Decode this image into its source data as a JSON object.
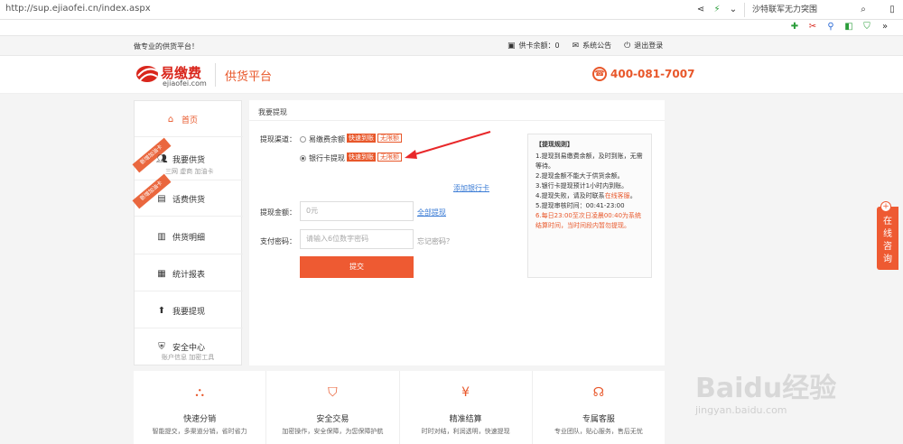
{
  "browser": {
    "url": "http://sup.ejiaofei.cn/index.aspx",
    "search_text": "沙特联军无力突围"
  },
  "topbar": {
    "slogan": "做专业的供货平台！",
    "balance_label": "供卡余额：0",
    "notice_label": "系统公告",
    "logout_label": "退出登录"
  },
  "header": {
    "brand_name": "易缴费",
    "brand_domain": "ejiaofei.com",
    "platform": "供货平台",
    "phone": "400-081-7007"
  },
  "sidebar": {
    "items": [
      {
        "label": "首页",
        "icon": "home-icon"
      },
      {
        "label": "我要供货",
        "sub": "三网 虚商 加油卡",
        "ribbon": "新增加油卡",
        "icon": "users-icon"
      },
      {
        "label": "话费供货",
        "ribbon": "新增加油卡",
        "icon": "phone-card-icon"
      },
      {
        "label": "供货明细",
        "icon": "bar-chart-icon"
      },
      {
        "label": "统计报表",
        "icon": "report-icon"
      },
      {
        "label": "我要提现",
        "icon": "withdraw-icon"
      },
      {
        "label": "安全中心",
        "sub": "账户信息 加密工具",
        "icon": "shield-icon"
      }
    ]
  },
  "main": {
    "breadcrumb": "我要提现",
    "channel_label": "提现渠道：",
    "option1": "易缴费余额",
    "option2": "银行卡提现",
    "tag_fast": "快速到账",
    "tag_free": "无限额",
    "add_card": "添加银行卡",
    "amount_label": "提现金额：",
    "amount_placeholder": "0元",
    "withdraw_all": "全部提现",
    "pwd_label": "支付密码：",
    "pwd_placeholder": "请输入6位数字密码",
    "forgot": "忘记密码？",
    "submit": "提交"
  },
  "rules": {
    "title": "【提现规则】",
    "r1": "1.提现到易缴费余额，及时到账，无需等待。",
    "r2": "2.提现金额不能大于供货余额。",
    "r3": "3.银行卡提现预计1小时内到账。",
    "r4a": "4.提现失败，请及时联系",
    "r4b": "在线客服",
    "r4c": "。",
    "r5": "5.提现审核时间：00:41-23:00",
    "r6": "6.每日23:00至次日凌晨00:40为系统结算时间，当时间段内暂勿提现。"
  },
  "online": {
    "label": "在线咨询"
  },
  "features": [
    {
      "title": "快速分销",
      "desc": "智能提交，多渠道分销，省时省力",
      "icon": "network-icon"
    },
    {
      "title": "安全交易",
      "desc": "加密操作，安全保障，为您保障护航",
      "icon": "shield-icon"
    },
    {
      "title": "精准结算",
      "desc": "时时对结，利润透明，快速提现",
      "icon": "yen-icon"
    },
    {
      "title": "专属客服",
      "desc": "专业团队，贴心服务，售后无忧",
      "icon": "headset-icon"
    }
  ],
  "watermark": {
    "brand": "Baidu经验",
    "url": "jingyan.baidu.com"
  },
  "colors": {
    "accent": "#e8572a",
    "link": "#3a7bd5"
  }
}
